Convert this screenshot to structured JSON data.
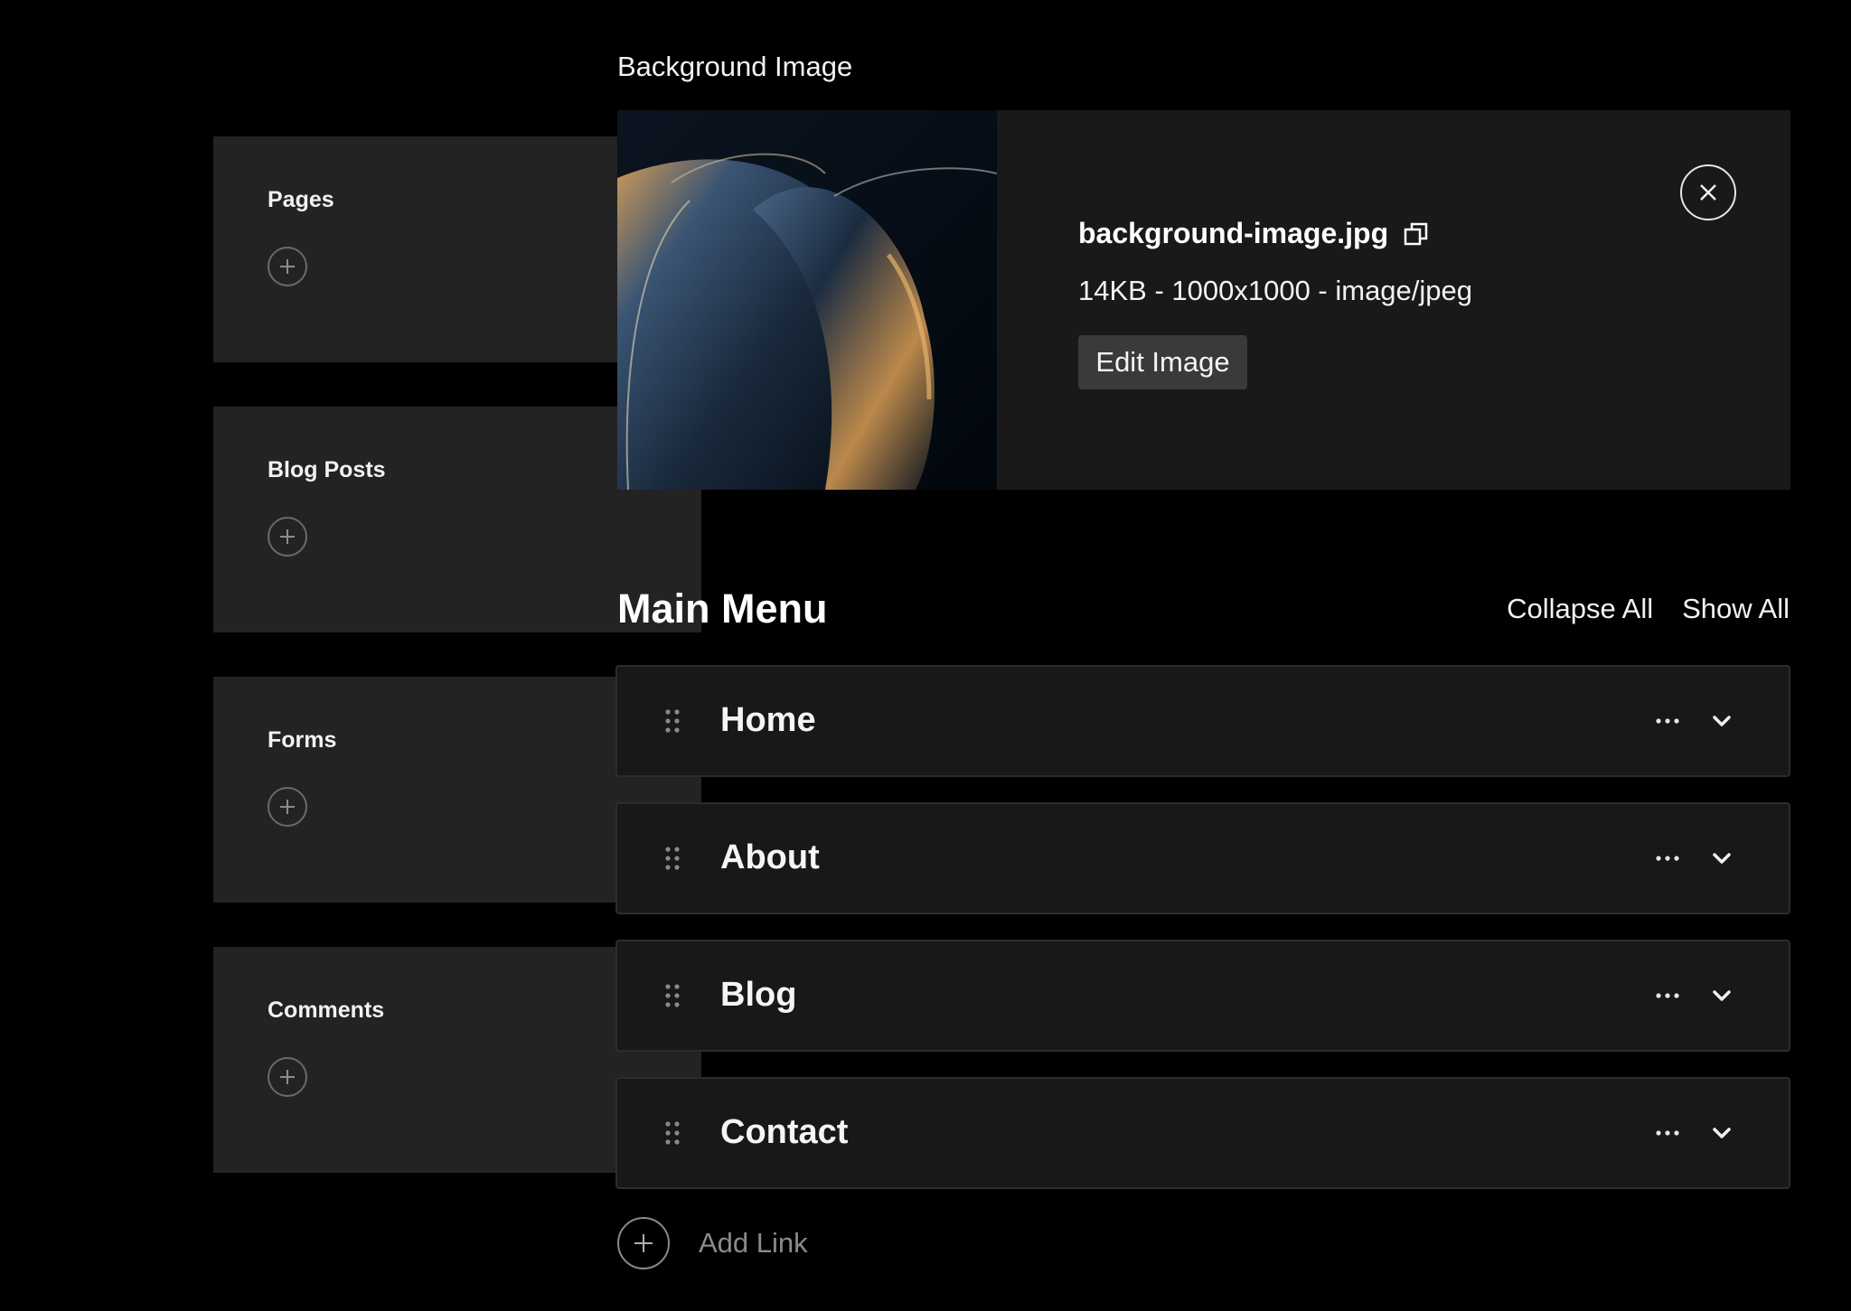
{
  "sidebar": {
    "cards": [
      {
        "title": "Pages"
      },
      {
        "title": "Blog Posts"
      },
      {
        "title": "Forms"
      },
      {
        "title": "Comments"
      }
    ]
  },
  "background_image": {
    "section_label": "Background Image",
    "file_name": "background-image.jpg",
    "meta": "14KB - 1000x1000 - image/jpeg",
    "edit_label": "Edit Image",
    "icons": [
      "copy-icon",
      "close-icon"
    ]
  },
  "main_menu": {
    "title": "Main Menu",
    "collapse_label": "Collapse All",
    "show_label": "Show All",
    "items": [
      {
        "label": "Home"
      },
      {
        "label": "About"
      },
      {
        "label": "Blog"
      },
      {
        "label": "Contact"
      }
    ],
    "add_link_label": "Add Link",
    "icons": [
      "drag-handle-icon",
      "more-icon",
      "chevron-down-icon",
      "plus-icon"
    ]
  },
  "colors": {
    "background": "#000000",
    "card": "#232323",
    "panel": "#191919",
    "menu_item": "#181818",
    "button": "#3a3a3a",
    "muted_text": "#8a8a8a"
  }
}
